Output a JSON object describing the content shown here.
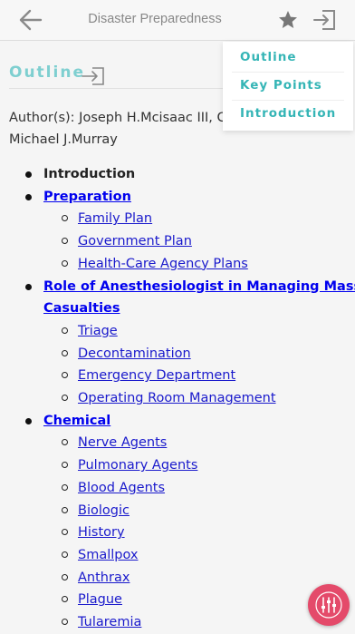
{
  "header": {
    "title": "Disaster Preparedness",
    "back_icon": "arrow-left-icon",
    "star_icon": "star-icon",
    "exit_icon": "exit-to-app-icon"
  },
  "outline": {
    "heading": "Outline",
    "icon": "exit-to-app-icon",
    "authors": "Author(s): Joseph H.Mcisaac III, C Michael J.Murray"
  },
  "dropdown": {
    "items": [
      {
        "label": "Outline"
      },
      {
        "label": "Key Points"
      },
      {
        "label": "Introduction"
      }
    ]
  },
  "toc": [
    {
      "label": "Introduction",
      "link": false
    },
    {
      "label": "Preparation",
      "link": true
    },
    {
      "label": "Family Plan",
      "link": true
    },
    {
      "label": "Government Plan",
      "link": true
    },
    {
      "label": "Health-Care Agency Plans",
      "link": true
    },
    {
      "label": "Role of Anesthesiologist in Managing Mass Casualties",
      "link": true
    },
    {
      "label": "Triage",
      "link": true
    },
    {
      "label": "Decontamination",
      "link": true
    },
    {
      "label": "Emergency Department",
      "link": true
    },
    {
      "label": "Operating Room Management",
      "link": true
    },
    {
      "label": "Chemical",
      "link": true
    },
    {
      "label": "Nerve Agents",
      "link": true
    },
    {
      "label": "Pulmonary Agents",
      "link": true
    },
    {
      "label": "Blood Agents",
      "link": true
    },
    {
      "label": "Biologic",
      "link": true
    },
    {
      "label": "History",
      "link": true
    },
    {
      "label": "Smallpox",
      "link": true
    },
    {
      "label": "Anthrax",
      "link": true
    },
    {
      "label": "Plague",
      "link": true
    },
    {
      "label": "Tularemia",
      "link": true
    }
  ],
  "fab": {
    "icon": "sliders-icon"
  },
  "colors": {
    "accent": "#35b5b6",
    "outline_heading": "#7ecfd0",
    "link": "#1a1acc",
    "fab": "#e44a6a"
  }
}
